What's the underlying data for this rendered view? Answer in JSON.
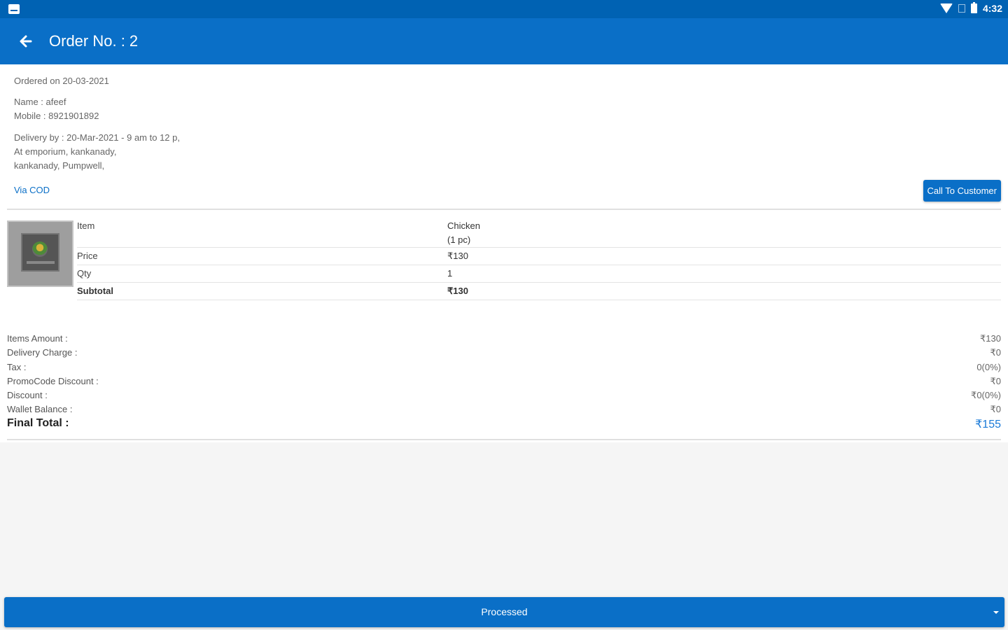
{
  "status_bar": {
    "time": "4:32"
  },
  "app_bar": {
    "title": "Order No. : 2"
  },
  "order": {
    "ordered_on": "Ordered on 20-03-2021",
    "name": "Name : afeef",
    "mobile": "Mobile : 8921901892",
    "delivery_by": "Delivery by : 20-Mar-2021 - 9 am to 12 p,",
    "address_line1": "At emporium, kankanady,",
    "address_line2": "kankanady, Pumpwell,",
    "payment_method": "Via COD",
    "call_button": "Call To Customer"
  },
  "item": {
    "image_icon": "product-image-icon",
    "rows": {
      "item_label": "Item",
      "item_name": "Chicken",
      "item_variant": "(1 pc)",
      "price_label": "Price",
      "price_value": "₹130",
      "qty_label": "Qty",
      "qty_value": "1",
      "subtotal_label": "Subtotal",
      "subtotal_value": "₹130"
    }
  },
  "summary": {
    "items_amount_label": "Items Amount :",
    "items_amount_value": "₹130",
    "delivery_charge_label": "Delivery Charge :",
    "delivery_charge_value": "₹0",
    "tax_label": "Tax :",
    "tax_value": "0(0%)",
    "promo_label": "PromoCode Discount :",
    "promo_value": "₹0",
    "discount_label": "Discount :",
    "discount_value": "₹0(0%)",
    "wallet_label": "Wallet Balance :",
    "wallet_value": "₹0",
    "final_label": "Final Total :",
    "final_value": "₹155"
  },
  "status_dropdown": {
    "selected": "Processed"
  },
  "colors": {
    "primary": "#0a6fc7",
    "status_bar": "#0062b3",
    "final_total": "#1a7ad8"
  }
}
